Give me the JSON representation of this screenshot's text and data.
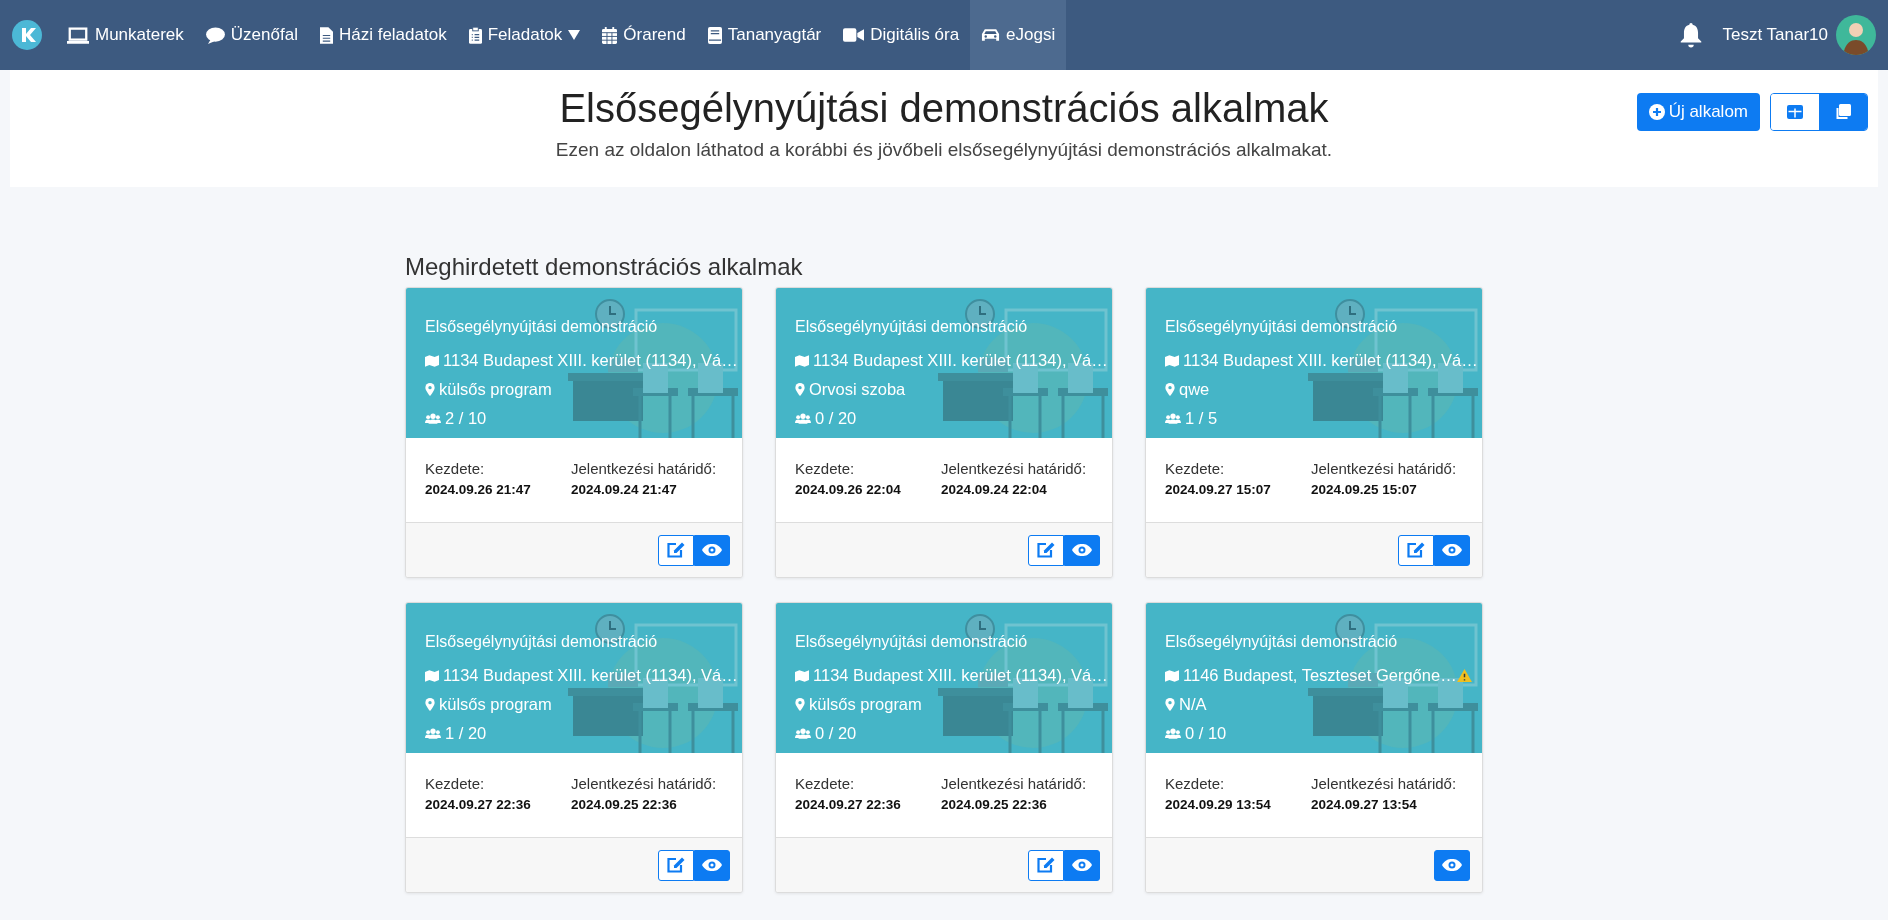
{
  "navbar": {
    "items": [
      {
        "label": "Munkaterek",
        "selected": false,
        "dropdown": false
      },
      {
        "label": "Üzenőfal",
        "selected": false,
        "dropdown": false
      },
      {
        "label": "Házi feladatok",
        "selected": false,
        "dropdown": false
      },
      {
        "label": "Feladatok",
        "selected": false,
        "dropdown": true
      },
      {
        "label": "Órarend",
        "selected": false,
        "dropdown": false
      },
      {
        "label": "Tananyagtár",
        "selected": false,
        "dropdown": false
      },
      {
        "label": "Digitális óra",
        "selected": false,
        "dropdown": false
      },
      {
        "label": "eJogsi",
        "selected": true,
        "dropdown": false
      }
    ],
    "user": "Teszt Tanar10"
  },
  "header": {
    "title": "Elsősegélynyújtási demonstrációs alkalmak",
    "subtitle": "Ezen az oldalon láthatod a korábbi és jövőbeli elsősegélynyújtási demonstrációs alkalmakat.",
    "new_button": "Új alkalom",
    "views": [
      {
        "selected": false
      },
      {
        "selected": true
      }
    ]
  },
  "section_title": "Meghirdetett demonstrációs alkalmak",
  "cards": [
    {
      "title": "Elsősegélynyújtási demonstráció",
      "address": "1134 Budapest XIII. kerület (1134), Vá…",
      "warning": false,
      "place": "külsős program",
      "capacity": "2 / 10",
      "start_label": "Kezdete:",
      "start": "2024.09.26 21:47",
      "deadline_label": "Jelentkezési határidő:",
      "deadline": "2024.09.24 21:47",
      "editable": true
    },
    {
      "title": "Elsősegélynyújtási demonstráció",
      "address": "1134 Budapest XIII. kerület (1134), Vá…",
      "warning": false,
      "place": "Orvosi szoba",
      "capacity": "0 / 20",
      "start_label": "Kezdete:",
      "start": "2024.09.26 22:04",
      "deadline_label": "Jelentkezési határidő:",
      "deadline": "2024.09.24 22:04",
      "editable": true
    },
    {
      "title": "Elsősegélynyújtási demonstráció",
      "address": "1134 Budapest XIII. kerület (1134), Vá…",
      "warning": false,
      "place": "qwe",
      "capacity": "1 / 5",
      "start_label": "Kezdete:",
      "start": "2024.09.27 15:07",
      "deadline_label": "Jelentkezési határidő:",
      "deadline": "2024.09.25 15:07",
      "editable": true
    },
    {
      "title": "Elsősegélynyújtási demonstráció",
      "address": "1134 Budapest XIII. kerület (1134), Vá…",
      "warning": false,
      "place": "külsős program",
      "capacity": "1 / 20",
      "start_label": "Kezdete:",
      "start": "2024.09.27 22:36",
      "deadline_label": "Jelentkezési határidő:",
      "deadline": "2024.09.25 22:36",
      "editable": true
    },
    {
      "title": "Elsősegélynyújtási demonstráció",
      "address": "1134 Budapest XIII. kerület (1134), Vá…",
      "warning": false,
      "place": "külsős program",
      "capacity": "0 / 20",
      "start_label": "Kezdete:",
      "start": "2024.09.27 22:36",
      "deadline_label": "Jelentkezési határidő:",
      "deadline": "2024.09.25 22:36",
      "editable": true
    },
    {
      "title": "Elsősegélynyújtási demonstráció",
      "address": "1146 Budapest, Teszteset Gergőne…",
      "warning": true,
      "place": "N/A",
      "capacity": "0 / 10",
      "start_label": "Kezdete:",
      "start": "2024.09.29 13:54",
      "deadline_label": "Jelentkezési határidő:",
      "deadline": "2024.09.27 13:54",
      "editable": false
    }
  ]
}
